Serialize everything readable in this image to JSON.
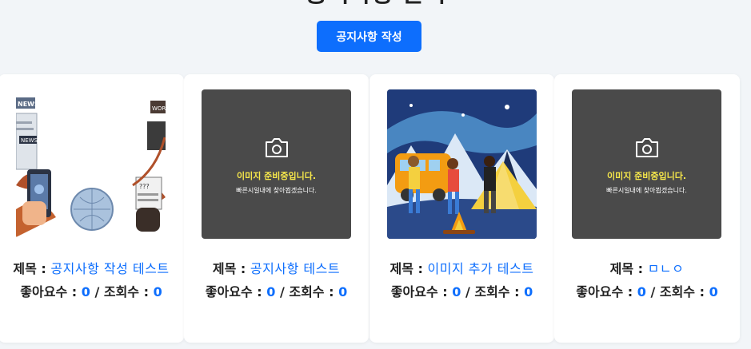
{
  "page": {
    "heading": "공지사항 관리"
  },
  "toolbar": {
    "write_label": "공지사항 작성"
  },
  "placeholder": {
    "title": "이미지 준비중입니다.",
    "subtitle": "빠른시일내에 찾아뵙겠습니다."
  },
  "labels": {
    "title_prefix": "제목 :",
    "likes_prefix": "좋아요수 :",
    "slash": "/",
    "views_prefix": "조회수 :"
  },
  "cards": [
    {
      "title": "공지사항 작성 테스트",
      "likes": "0",
      "views": "0",
      "image": "news-illustration"
    },
    {
      "title": "공지사항 테스트",
      "likes": "0",
      "views": "0",
      "image": "placeholder"
    },
    {
      "title": "이미지 추가 테스트",
      "likes": "0",
      "views": "0",
      "image": "camping-illustration"
    },
    {
      "title": "ㅁㄴㅇ",
      "likes": "0",
      "views": "0",
      "image": "placeholder"
    }
  ],
  "colors": {
    "accent": "#0d6efd",
    "placeholder_bg": "#4a4a4a",
    "placeholder_text": "#f7e84a"
  }
}
